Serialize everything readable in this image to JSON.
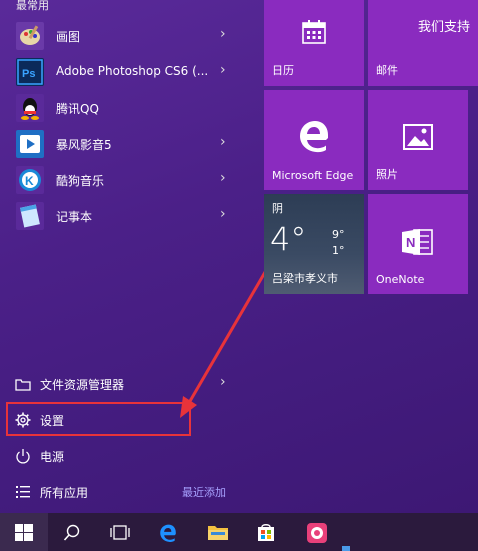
{
  "left": {
    "section_title": "最常用",
    "apps": [
      {
        "label": "画图",
        "icon": "paint-icon"
      },
      {
        "label": "Adobe Photoshop CS6 (...",
        "icon": "photoshop-icon"
      },
      {
        "label": "腾讯QQ",
        "icon": "qq-icon"
      },
      {
        "label": "暴风影音5",
        "icon": "baofeng-icon"
      },
      {
        "label": "酷狗音乐",
        "icon": "kugou-icon"
      },
      {
        "label": "记事本",
        "icon": "notepad-icon"
      }
    ],
    "system": [
      {
        "label": "文件资源管理器",
        "icon": "folder-icon"
      },
      {
        "label": "设置",
        "icon": "gear-icon"
      },
      {
        "label": "电源",
        "icon": "power-icon"
      },
      {
        "label": "所有应用",
        "icon": "list-icon"
      }
    ],
    "recent_label": "最近添加"
  },
  "tiles": {
    "support_title": "我们支持",
    "calendar": "日历",
    "mail": "邮件",
    "edge": "Microsoft Edge",
    "photos": "照片",
    "weather_condition": "阴",
    "weather_temp": "4°",
    "weather_high": "9°",
    "weather_low": "1°",
    "weather_location": "吕梁市孝义市",
    "onenote": "OneNote"
  },
  "colors": {
    "tile": "#8a2bbf",
    "accent_recent": "#a8a2ff",
    "highlight": "#e8333a",
    "taskbar": "#2b1a3d"
  }
}
